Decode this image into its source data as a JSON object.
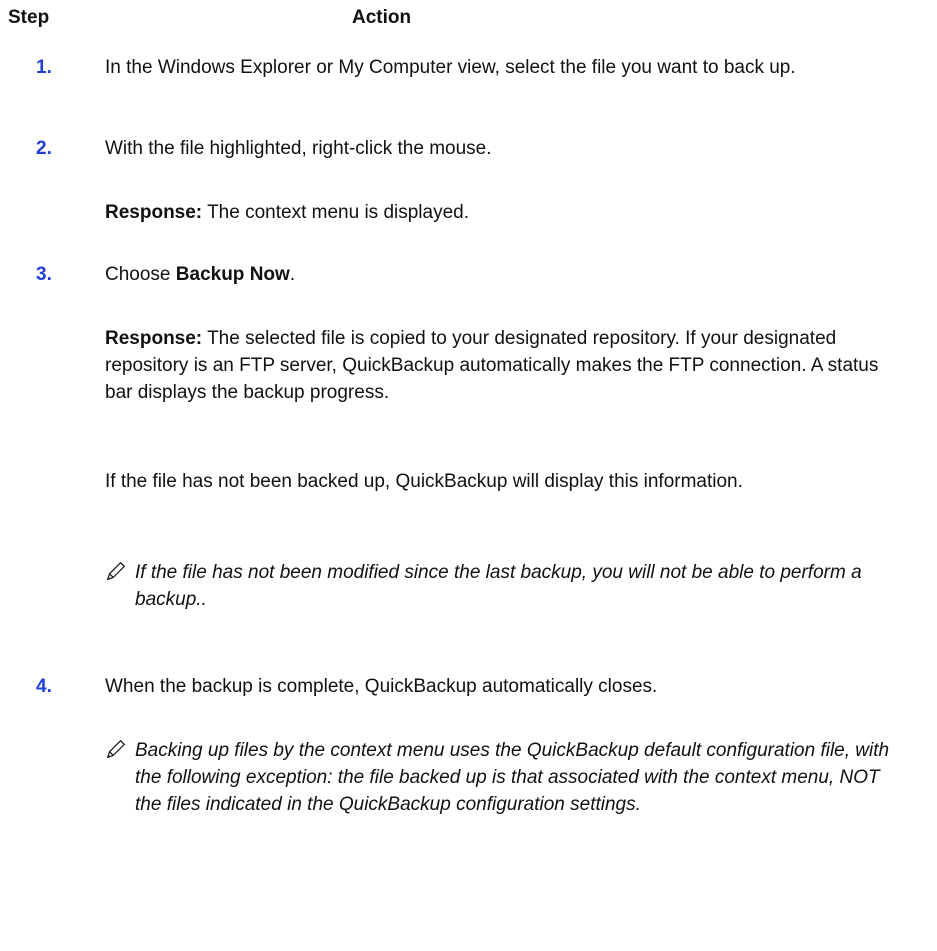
{
  "header": {
    "step": "Step",
    "action": "Action"
  },
  "steps": [
    {
      "number": "1.",
      "text": "In the Windows Explorer or My Computer view, select the file you want to back up."
    },
    {
      "number": "2.",
      "text": "With the file highlighted, right-click the mouse.",
      "response_label": "Response:",
      "response_text": " The context menu is displayed."
    },
    {
      "number": "3.",
      "text_prefix": "Choose ",
      "text_bold": "Backup Now",
      "text_suffix": ".",
      "response_label": "Response:",
      "response_text": " The selected file is copied to your designated repository. If your designated repository is an FTP server, QuickBackup automatically makes the FTP connection. A status bar displays the backup progress.",
      "extra": "If the file has not been backed up, QuickBackup will display this information.",
      "note": "If the file has not been modified since the last backup, you will not be able to perform a backup.."
    },
    {
      "number": "4.",
      "text": "When the backup is complete, QuickBackup automatically closes.",
      "note": "Backing up files by the context menu uses the QuickBackup default configuration file, with the following exception: the file backed up is that associated with the context menu, NOT the files indicated in the QuickBackup configuration settings."
    }
  ],
  "colors": {
    "step_number": "#1f3fd6",
    "text": "#111111"
  },
  "icons": {
    "note": "pencil-icon"
  }
}
